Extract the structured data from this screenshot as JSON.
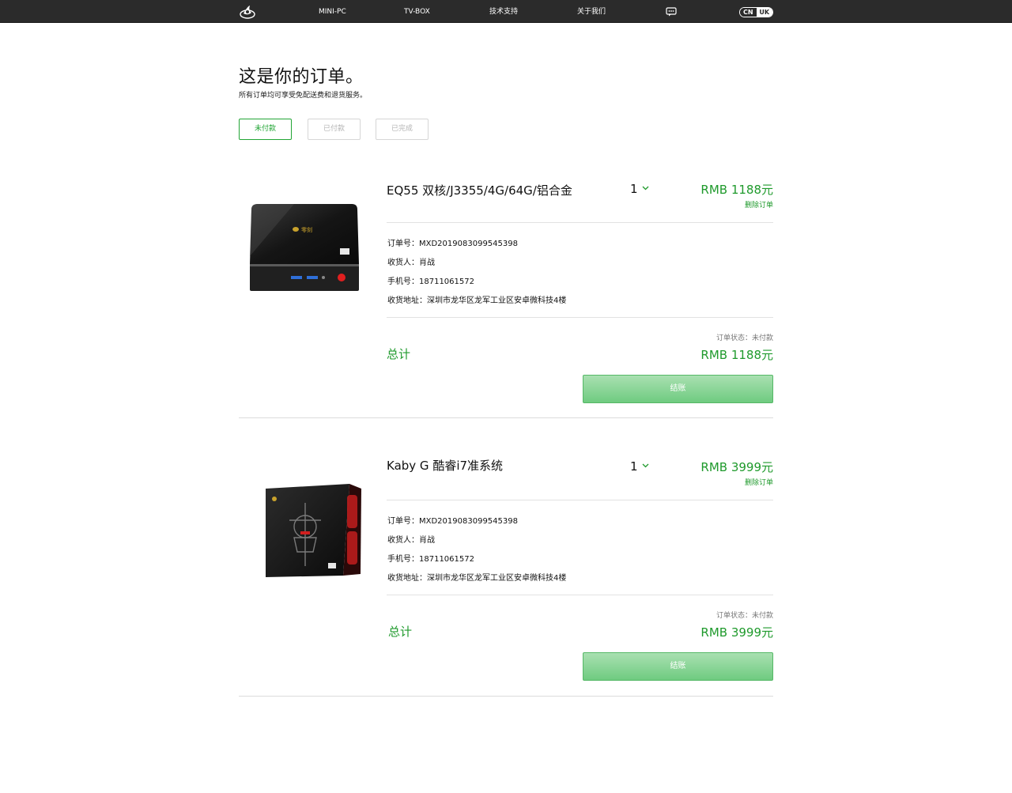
{
  "nav": {
    "logo_icon": "brand-logo-icon",
    "items": [
      "MINI-PC",
      "TV-BOX",
      "技术支持",
      "关于我们"
    ],
    "chat_icon": "chat-bubble-icon",
    "lang": {
      "active": "CN",
      "inactive": "UK"
    }
  },
  "header": {
    "title": "这是你的订单。",
    "subtitle": "所有订单均可享受免配送费和退货服务。"
  },
  "tabs": [
    {
      "label": "未付款",
      "active": true
    },
    {
      "label": "已付款",
      "active": false
    },
    {
      "label": "已完成",
      "active": false
    }
  ],
  "orders": [
    {
      "image_icon": "mini-pc-silver-box-image",
      "name": "EQ55 双核/J3355/4G/64G/铝合金",
      "qty": "1",
      "price": "RMB 1188元",
      "delete_label": "删除订单",
      "order_no": "订单号：MXD2019083099545398",
      "receiver": "收货人：肖战",
      "phone": "手机号：18711061572",
      "address": "收货地址：深圳市龙华区龙军工业区安卓微科技4楼",
      "status": "订单状态：未付款",
      "total_label": "总计",
      "total_price": "RMB 1188元",
      "checkout_label": "结账"
    },
    {
      "image_icon": "mini-pc-kaby-g-image",
      "name": "Kaby G 酷睿i7准系统",
      "qty": "1",
      "price": "RMB 3999元",
      "delete_label": "删除订单",
      "order_no": "订单号：MXD2019083099545398",
      "receiver": "收货人：肖战",
      "phone": "手机号：18711061572",
      "address": "收货地址：深圳市龙华区龙军工业区安卓微科技4楼",
      "status": "订单状态：未付款",
      "total_label": "总计",
      "total_price": "RMB 3999元",
      "checkout_label": "结账"
    }
  ],
  "colors": {
    "accent_green": "#1f9a2c",
    "nav_bg": "#2b2b2b",
    "button_green": "#6fcb80"
  }
}
